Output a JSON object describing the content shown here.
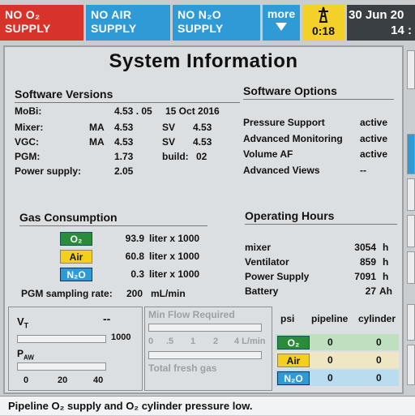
{
  "alarms": [
    {
      "label": "NO O₂ SUPPLY",
      "color": "#d8332a"
    },
    {
      "label": "NO AIR SUPPLY",
      "color": "#2e9ad6"
    },
    {
      "label": "NO N₂O SUPPLY",
      "color": "#2e9ad6"
    }
  ],
  "more_button": {
    "label": "more",
    "icon": "chevron-down-icon"
  },
  "timer": {
    "icon": "warning-tower-icon",
    "value": "0:18"
  },
  "datetime": {
    "date": "30  Jun  20",
    "time": "14 :"
  },
  "title": "System Information",
  "software_versions": {
    "heading": "Software Versions",
    "rows": [
      {
        "label": "MoBi:",
        "col1": "",
        "v1": "4.53 . 05",
        "col2": "15  Oct  2016",
        "v2": ""
      },
      {
        "label": "Mixer:",
        "col1": "MA",
        "v1": "4.53",
        "col2": "SV",
        "v2": "4.53"
      },
      {
        "label": "VGC:",
        "col1": "MA",
        "v1": "4.53",
        "col2": "SV",
        "v2": "4.53"
      },
      {
        "label": "PGM:",
        "col1": "",
        "v1": "1.73",
        "col2": "build:",
        "v2": "02"
      },
      {
        "label": "Power supply:",
        "col1": "",
        "v1": "2.05",
        "col2": "",
        "v2": ""
      }
    ]
  },
  "software_options": {
    "heading": "Software Options",
    "rows": [
      {
        "label": "Pressure Support",
        "value": "active"
      },
      {
        "label": "Advanced Monitoring",
        "value": "active"
      },
      {
        "label": "Volume AF",
        "value": "active"
      },
      {
        "label": "Advanced Views",
        "value": "--"
      }
    ]
  },
  "gas_consumption": {
    "heading": "Gas Consumption",
    "rows": [
      {
        "gas": "O₂",
        "value": "93.9",
        "unit": "liter x 1000"
      },
      {
        "gas": "Air",
        "value": "60.8",
        "unit": "liter x 1000"
      },
      {
        "gas": "N₂O",
        "value": "0.3",
        "unit": "liter x 1000"
      }
    ],
    "pgm_label": "PGM sampling rate:",
    "pgm_value": "200",
    "pgm_unit": "mL/min"
  },
  "operating_hours": {
    "heading": "Operating Hours",
    "rows": [
      {
        "label": "mixer",
        "value": "3054",
        "unit": "h"
      },
      {
        "label": "Ventilator",
        "value": "859",
        "unit": "h"
      },
      {
        "label": "Power Supply",
        "value": "7091",
        "unit": "h"
      },
      {
        "label": "Battery",
        "value": "27",
        "unit": "Ah"
      }
    ]
  },
  "gauges": {
    "vt_label": "V",
    "vt_sub": "T",
    "vt_value": "--",
    "vt_max": "1000",
    "paw_label": "P",
    "paw_sub": "AW",
    "paw_ticks": [
      "0",
      "20",
      "40"
    ],
    "flow_title": "Min Flow Required",
    "flow_ticks": [
      "0",
      ".5",
      "1",
      "2",
      "4 L/min"
    ],
    "fresh_gas": "Total fresh gas"
  },
  "pressure_table": {
    "headers": [
      "psi",
      "pipeline",
      "cylinder"
    ],
    "rows": [
      {
        "gas": "O₂",
        "pipeline": "0",
        "cylinder": "0",
        "row_color": "#bfe0bf"
      },
      {
        "gas": "Air",
        "pipeline": "0",
        "cylinder": "0",
        "row_color": "#efe7c4"
      },
      {
        "gas": "N₂O",
        "pipeline": "0",
        "cylinder": "0",
        "row_color": "#b9dcef"
      }
    ]
  },
  "status_message": "Pipeline O₂ supply and O₂ cylinder pressure low."
}
